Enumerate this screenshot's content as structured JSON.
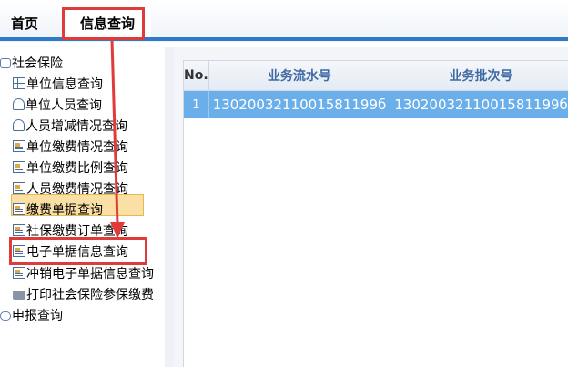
{
  "tabs": {
    "home": "首页",
    "active": "信息查询"
  },
  "tree": {
    "root1": "社会保险",
    "items": [
      "单位信息查询",
      "单位人员查询",
      "人员增减情况查询",
      "单位缴费情况查询",
      "单位缴费比例查询",
      "人员缴费情况查询",
      "缴费单据查询",
      "社保缴费订单查询",
      "电子单据信息查询",
      "冲销电子单据信息查询",
      "打印社会保险参保缴费"
    ],
    "root2": "申报查询"
  },
  "table": {
    "headers": [
      "No.",
      "业务流水号",
      "业务批次号"
    ],
    "rows": [
      {
        "no": "1",
        "serial": "1302003211001581199б",
        "batch": "1302003211001581199б"
      }
    ]
  },
  "colors": {
    "accent": "#2f79c9",
    "highlight": "#e03b3b",
    "selected_row": "#6aaeea"
  }
}
